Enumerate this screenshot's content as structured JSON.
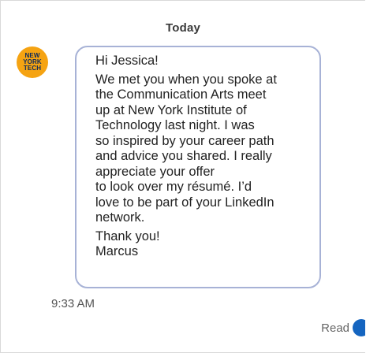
{
  "conversation": {
    "date_label": "Today"
  },
  "sender": {
    "avatar_lines": [
      "NEW",
      "YORK",
      "TECH"
    ],
    "avatar_color": "#f5a312"
  },
  "message": {
    "greeting": "Hi Jessica!",
    "body": "We met you when you spoke at\nthe Communication Arts meet\nup at New York Institute of\nTechnology last night. I was\nso inspired by your career path\nand advice you shared. I really\nappreciate your offer\nto look over my résumé. I’d\nlove to be part of your LinkedIn\nnetwork.",
    "closing": "Thank you!\nMarcus",
    "time": "9:33 AM"
  },
  "status": {
    "read_label": "Read",
    "read_color": "#1565c0"
  }
}
